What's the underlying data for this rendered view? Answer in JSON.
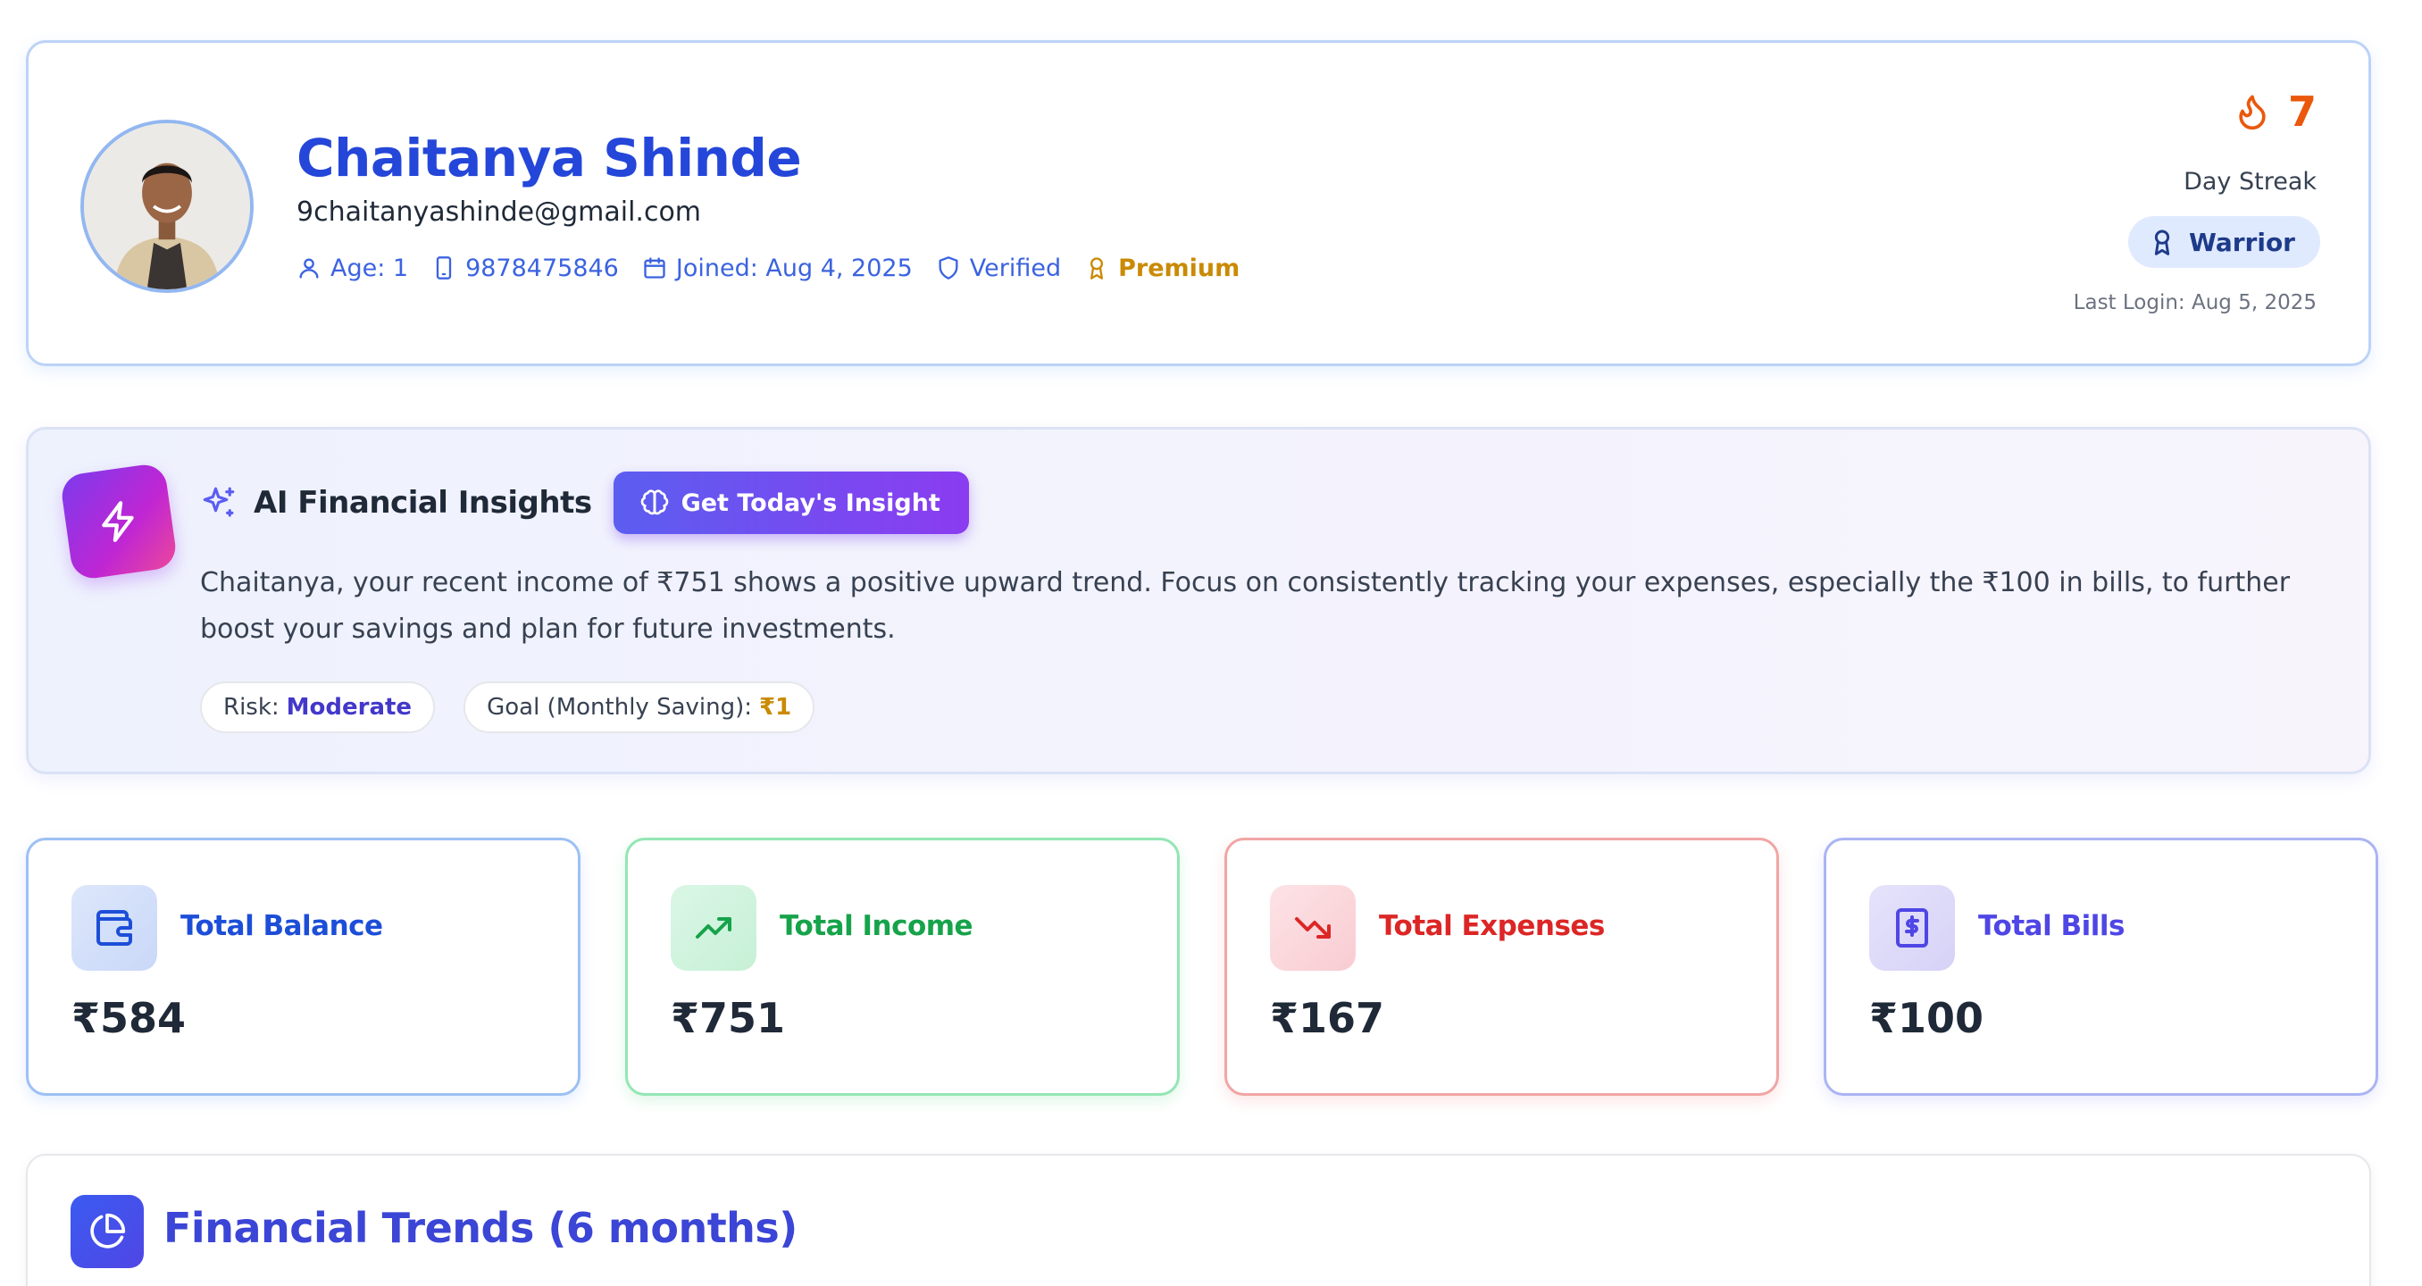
{
  "profile": {
    "name": "Chaitanya Shinde",
    "email": "9chaitanyashinde@gmail.com",
    "age": "Age: 1",
    "phone": "9878475846",
    "joined": "Joined: Aug 4, 2025",
    "verified": "Verified",
    "plan": "Premium",
    "streak_count": "7",
    "streak_label": "Day Streak",
    "rank_badge": "Warrior",
    "last_login": "Last Login: Aug 5, 2025"
  },
  "insights": {
    "title": "AI Financial Insights",
    "button_label": "Get Today's Insight",
    "text": "Chaitanya, your recent income of ₹751 shows a positive upward trend. Focus on consistently tracking your expenses, especially the ₹100 in bills, to further boost your savings and plan for future investments.",
    "risk_label": "Risk:",
    "risk_value": "Moderate",
    "goal_label": "Goal (Monthly Saving):",
    "goal_value": "₹1"
  },
  "stats": {
    "balance": {
      "label": "Total Balance",
      "value": "₹584",
      "icon": "wallet-icon"
    },
    "income": {
      "label": "Total Income",
      "value": "₹751",
      "icon": "trending-up-icon"
    },
    "expenses": {
      "label": "Total Expenses",
      "value": "₹167",
      "icon": "trending-down-icon"
    },
    "bills": {
      "label": "Total Bills",
      "value": "₹100",
      "icon": "receipt-dollar-icon"
    }
  },
  "trends": {
    "title": "Financial Trends (6 months)",
    "icon": "pie-chart-icon"
  },
  "colors": {
    "primary": "#2446d9",
    "streak": "#ea580c",
    "premium": "#ca8a04",
    "income": "#16a34a",
    "expenses": "#dc2626",
    "bills": "#4f46e5"
  }
}
